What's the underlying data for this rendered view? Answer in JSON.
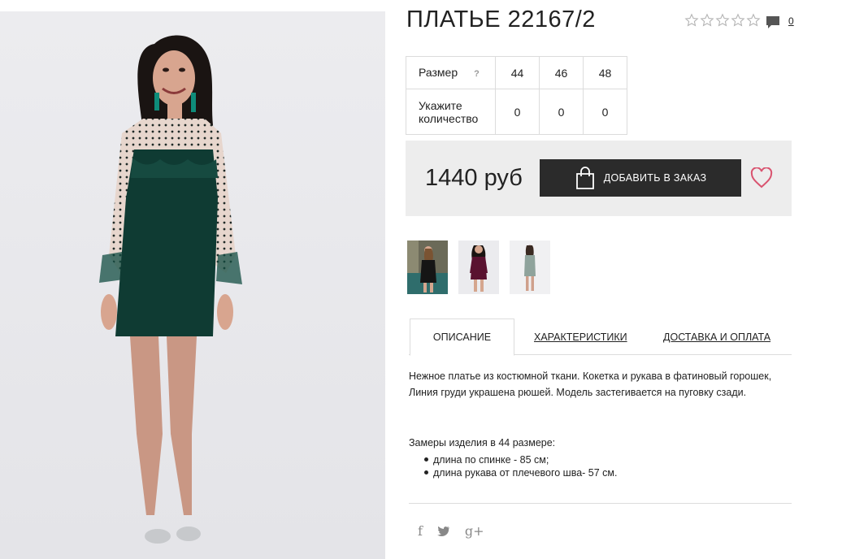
{
  "product": {
    "title": "ПЛАТЬЕ 22167/2",
    "comments_count": "0",
    "rating_stars": 0,
    "rating_max": 5
  },
  "size_table": {
    "size_label": "Размер",
    "help": "?",
    "quantity_label": "Укажите количество",
    "sizes": [
      "44",
      "46",
      "48"
    ],
    "quantities": [
      "0",
      "0",
      "0"
    ]
  },
  "purchase": {
    "price": "1440 руб",
    "order_button": "ДОБАВИТЬ В ЗАКАЗ",
    "wishlist_icon": "heart-icon"
  },
  "thumbnails": [
    {
      "name": "thumb-black-dress"
    },
    {
      "name": "thumb-burgundy-dress"
    },
    {
      "name": "thumb-grey-dress"
    }
  ],
  "tabs": [
    {
      "label": "ОПИСАНИЕ",
      "active": true
    },
    {
      "label": "ХАРАКТЕРИСТИКИ",
      "active": false
    },
    {
      "label": "ДОСТАВКА И ОПЛАТА",
      "active": false
    }
  ],
  "description": {
    "text": "Нежное платье из костюмной ткани. Кокетка и рукава в фатиновый горошек, Линия груди украшена рюшей. Модель застегивается на пуговку сзади.",
    "measurements_title": "Замеры изделия в 44 размере:",
    "measurements": [
      "длина по спинке - 85 см;",
      "длина рукава от плечевого шва- 57 см."
    ]
  },
  "social": {
    "facebook": "f",
    "twitter_icon": "twitter-icon",
    "googleplus": "g+"
  },
  "colors": {
    "dark_button": "#2b2b2b",
    "price_bg": "#ededed",
    "heart": "#d9536f",
    "dress": "#0f3b33"
  }
}
